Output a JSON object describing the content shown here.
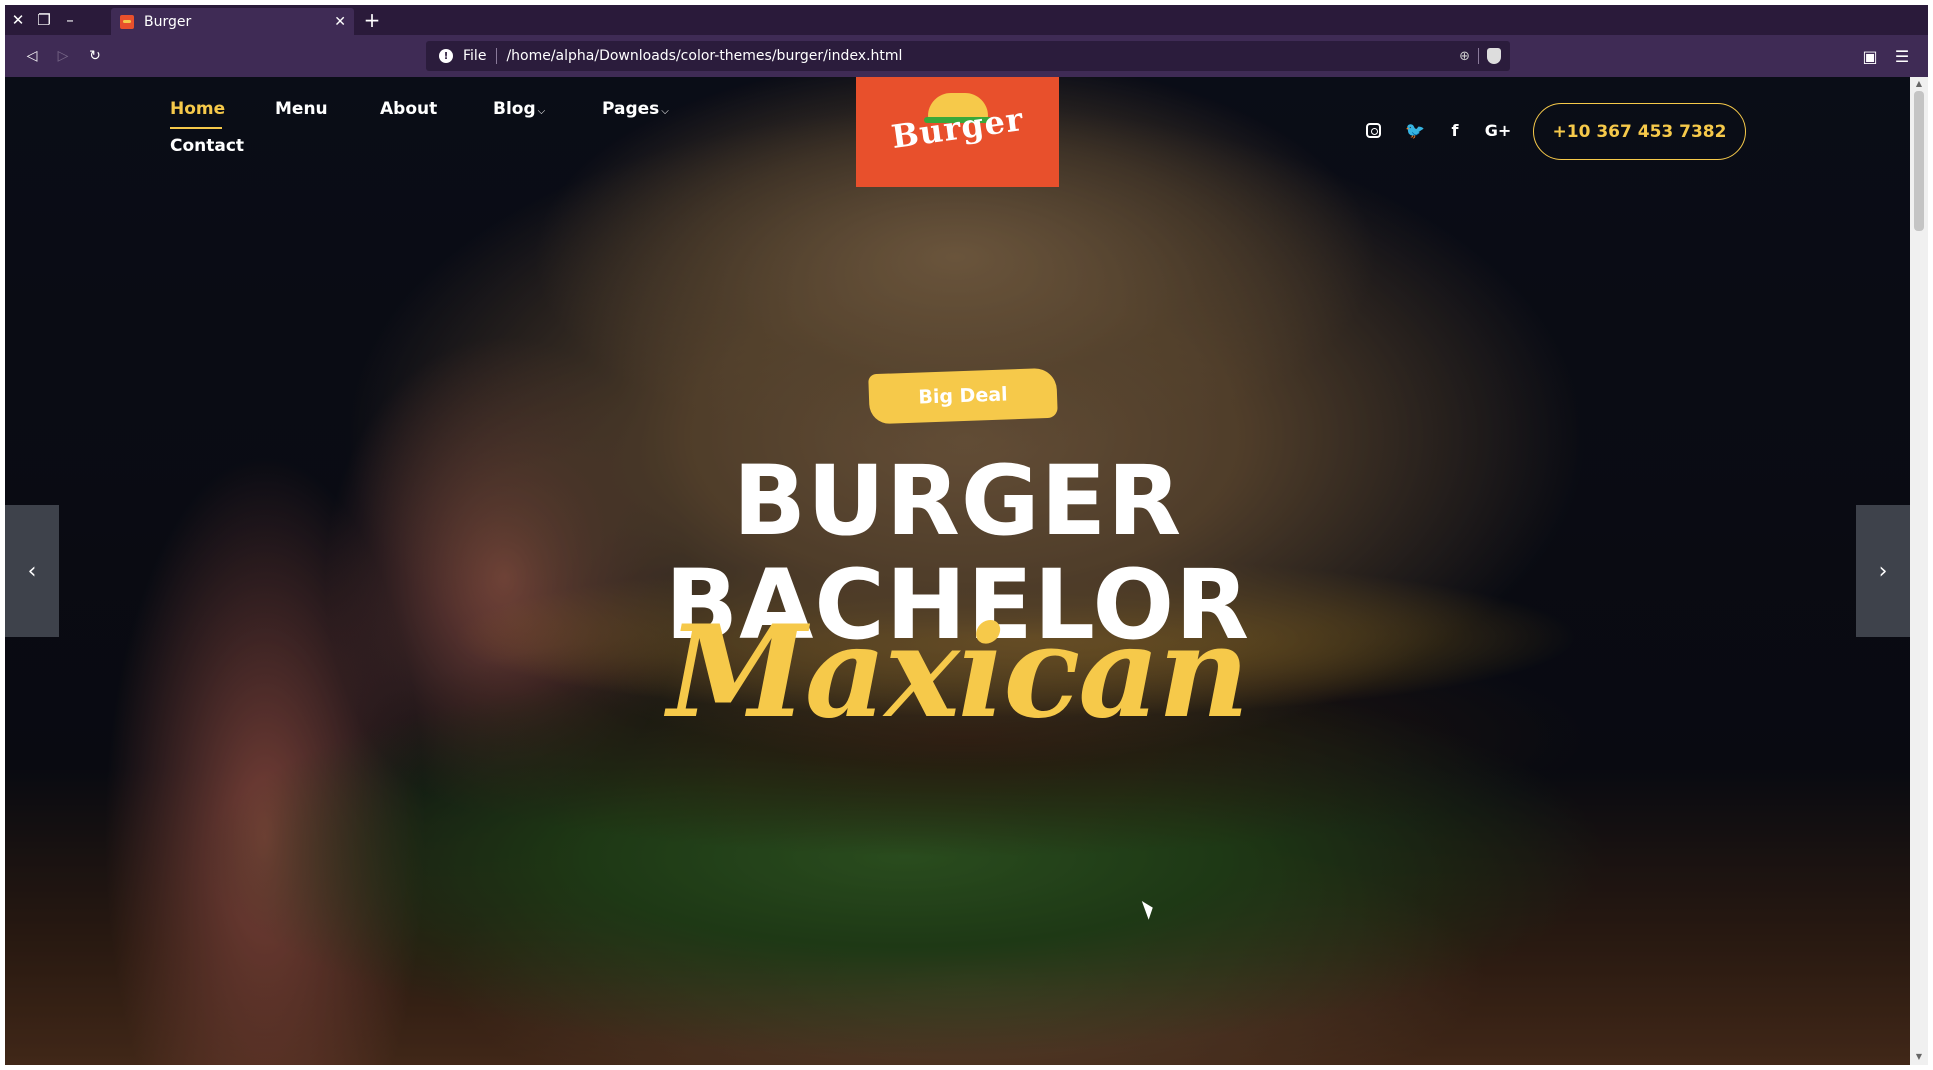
{
  "browser": {
    "tab_title": "Burger",
    "tab_close": "✕",
    "new_tab": "+",
    "address_prefix": "File",
    "url": "/home/alpha/Downloads/color-themes/burger/index.html"
  },
  "nav": {
    "items": [
      {
        "label": "Home",
        "active": true
      },
      {
        "label": "Menu"
      },
      {
        "label": "About"
      },
      {
        "label": "Blog",
        "has_dropdown": true
      },
      {
        "label": "Pages",
        "has_dropdown": true
      },
      {
        "label": "Contact"
      }
    ],
    "dropdown_caret": "⌵"
  },
  "logo": {
    "text": "Burger"
  },
  "social": [
    "instagram-icon",
    "twitter-icon",
    "facebook-icon",
    "google-plus-icon"
  ],
  "social_glyphs": {
    "twitter": "🐦",
    "facebook": "f",
    "google_plus": "G+"
  },
  "phone": "+10 367 453 7382",
  "hero": {
    "badge": "Big Deal",
    "line1": "BURGER",
    "line2": "BACHELOR",
    "script": "Maxican",
    "prev_arrow": "‹",
    "next_arrow": "›"
  },
  "colors": {
    "accent": "#f6c94a",
    "logo_bg": "#e8502c",
    "browser_chrome": "#3f2b55"
  }
}
